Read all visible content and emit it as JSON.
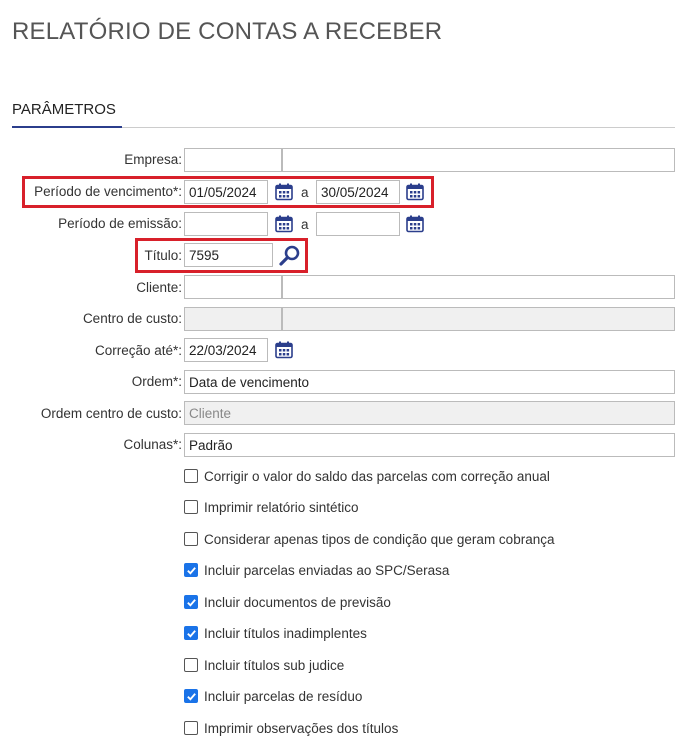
{
  "page_title": "RELATÓRIO DE CONTAS A RECEBER",
  "section_title": "PARÂMETROS",
  "fields": {
    "empresa": {
      "label": "Empresa:",
      "code": "",
      "name": ""
    },
    "periodo_vencimento": {
      "label": "Período de vencimento*:",
      "from": "01/05/2024",
      "separator": "a",
      "to": "30/05/2024"
    },
    "periodo_emissao": {
      "label": "Período de emissão:",
      "from": "",
      "separator": "a",
      "to": ""
    },
    "titulo": {
      "label": "Título:",
      "value": "7595"
    },
    "cliente": {
      "label": "Cliente:",
      "code": "",
      "name": ""
    },
    "centro_custo": {
      "label": "Centro de custo:",
      "code": "",
      "name": ""
    },
    "correcao_ate": {
      "label": "Correção até*:",
      "value": "22/03/2024"
    },
    "ordem": {
      "label": "Ordem*:",
      "value": "Data de vencimento"
    },
    "ordem_centro_custo": {
      "label": "Ordem centro de custo:",
      "value": "Cliente"
    },
    "colunas": {
      "label": "Colunas*:",
      "value": "Padrão"
    }
  },
  "checkboxes": [
    {
      "label": "Corrigir o valor do saldo das parcelas com correção anual",
      "checked": false
    },
    {
      "label": "Imprimir relatório sintético",
      "checked": false
    },
    {
      "label": "Considerar apenas tipos de condição que geram cobrança",
      "checked": false
    },
    {
      "label": "Incluir parcelas enviadas ao SPC/Serasa",
      "checked": true
    },
    {
      "label": "Incluir documentos de previsão",
      "checked": true
    },
    {
      "label": "Incluir títulos inadimplentes",
      "checked": true
    },
    {
      "label": "Incluir títulos sub judice",
      "checked": false
    },
    {
      "label": "Incluir parcelas de resíduo",
      "checked": true
    },
    {
      "label": "Imprimir observações dos títulos",
      "checked": false
    }
  ],
  "colors": {
    "accent": "#2b3e8c",
    "highlight": "#d8202a",
    "checkbox_on": "#1a73e8"
  }
}
